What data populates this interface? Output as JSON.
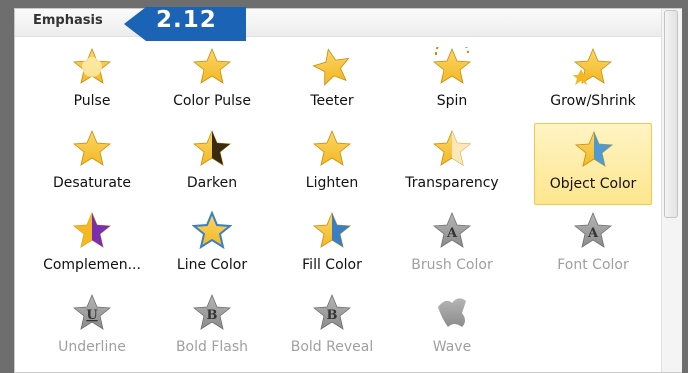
{
  "panel": {
    "title": "Emphasis",
    "callout": "2.12"
  },
  "items": [
    {
      "label": "Pulse",
      "icon": "pulse-star-icon",
      "enabled": true
    },
    {
      "label": "Color Pulse",
      "icon": "color-pulse-star-icon",
      "enabled": true
    },
    {
      "label": "Teeter",
      "icon": "teeter-star-icon",
      "enabled": true
    },
    {
      "label": "Spin",
      "icon": "spin-star-icon",
      "enabled": true
    },
    {
      "label": "Grow/Shrink",
      "icon": "grow-shrink-star-icon",
      "enabled": true
    },
    {
      "label": "Desaturate",
      "icon": "desaturate-star-icon",
      "enabled": true
    },
    {
      "label": "Darken",
      "icon": "darken-star-icon",
      "enabled": true
    },
    {
      "label": "Lighten",
      "icon": "lighten-star-icon",
      "enabled": true
    },
    {
      "label": "Transparency",
      "icon": "transparency-star-icon",
      "enabled": true
    },
    {
      "label": "Object Color",
      "icon": "object-color-star-icon",
      "enabled": true,
      "selected": true
    },
    {
      "label": "Complemen...",
      "icon": "complementary-color-star-icon",
      "enabled": true
    },
    {
      "label": "Line Color",
      "icon": "line-color-star-icon",
      "enabled": true
    },
    {
      "label": "Fill Color",
      "icon": "fill-color-star-icon",
      "enabled": true
    },
    {
      "label": "Brush Color",
      "icon": "brush-color-star-icon",
      "enabled": false
    },
    {
      "label": "Font Color",
      "icon": "font-color-star-icon",
      "enabled": false
    },
    {
      "label": "Underline",
      "icon": "underline-star-icon",
      "enabled": false
    },
    {
      "label": "Bold Flash",
      "icon": "bold-flash-star-icon",
      "enabled": false
    },
    {
      "label": "Bold Reveal",
      "icon": "bold-reveal-star-icon",
      "enabled": false
    },
    {
      "label": "Wave",
      "icon": "wave-star-icon",
      "enabled": false
    }
  ],
  "colors": {
    "callout": "#1b63b5",
    "star_gold": "#f5b822",
    "star_gray": "#8c8c8c",
    "selected_fill": "#fde68f"
  }
}
